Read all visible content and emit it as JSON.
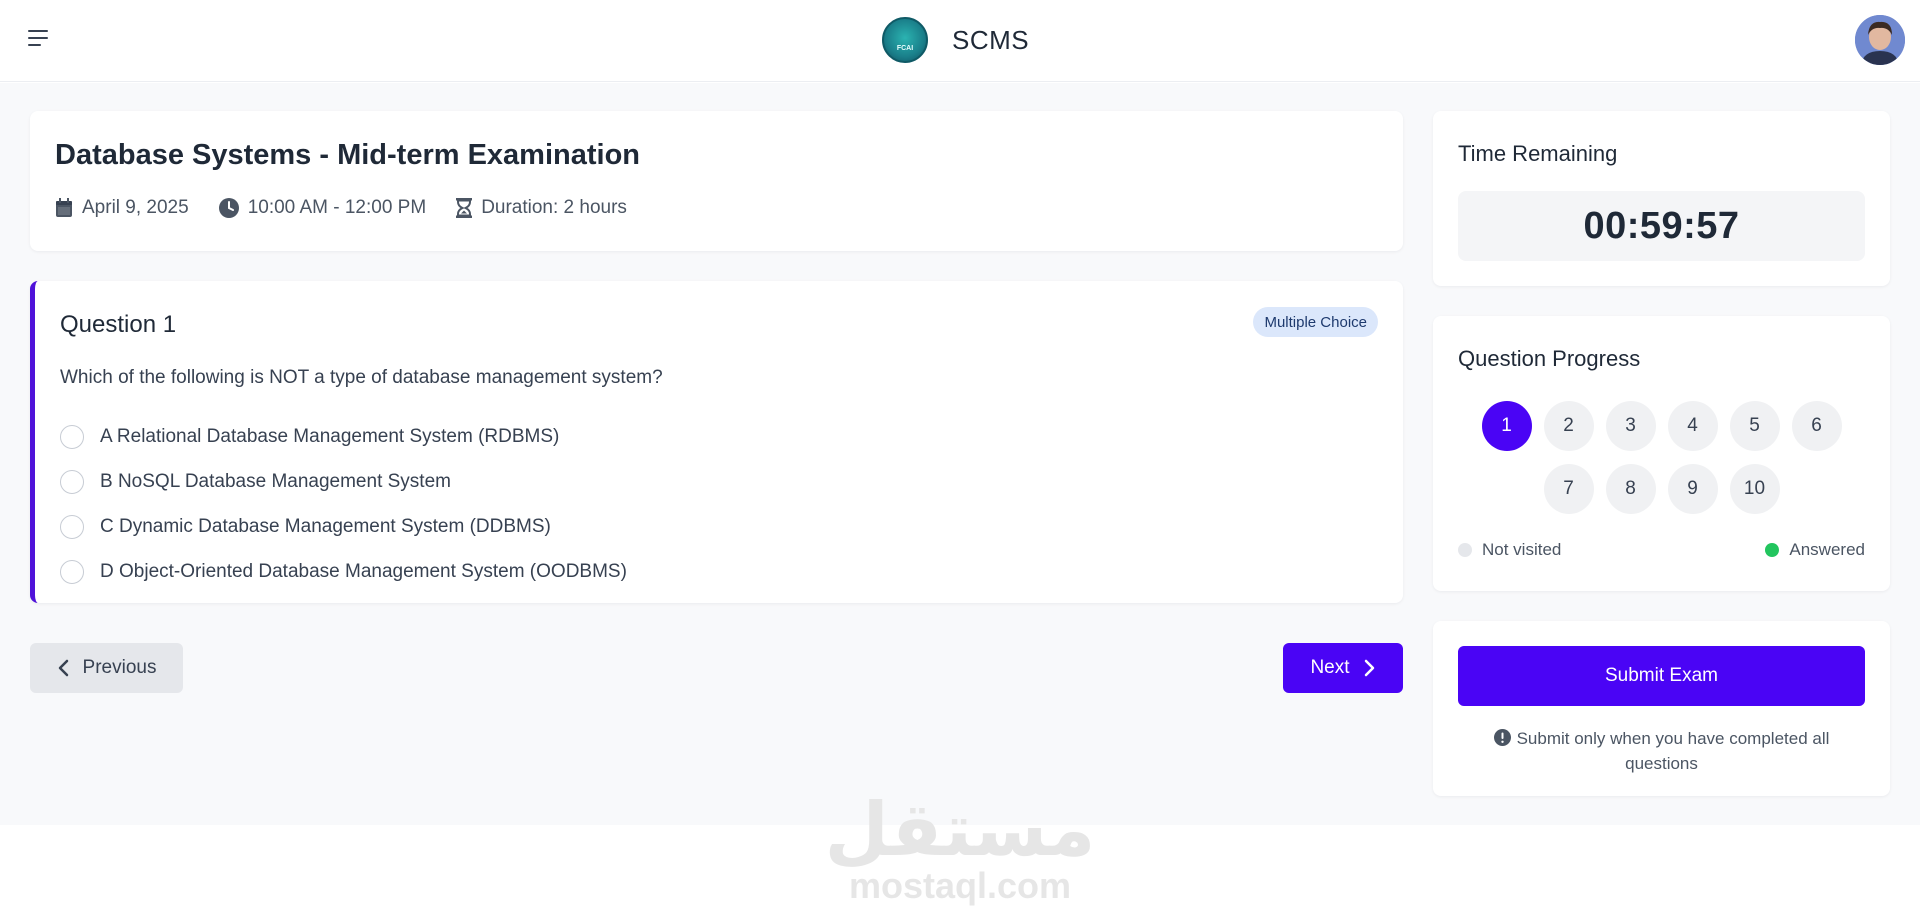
{
  "header": {
    "brand_name": "SCMS",
    "logo_text": "FCAI",
    "icons": {
      "menu": "menu-icon",
      "avatar": "user-avatar"
    }
  },
  "exam": {
    "title": "Database Systems - Mid-term Examination",
    "date": "April 9, 2025",
    "time": "10:00 AM - 12:00 PM",
    "duration": "Duration: 2 hours",
    "icons": {
      "date": "calendar-icon",
      "time": "clock-icon",
      "duration": "hourglass-icon"
    }
  },
  "question": {
    "title": "Question 1",
    "type_badge": "Multiple Choice",
    "text": "Which of the following is NOT a type of database management system?",
    "options": [
      {
        "label": "A Relational Database Management System (RDBMS)"
      },
      {
        "label": "B NoSQL Database Management System"
      },
      {
        "label": "C Dynamic Database Management System (DDBMS)"
      },
      {
        "label": "D Object-Oriented Database Management System (OODBMS)"
      }
    ]
  },
  "navigation": {
    "previous_label": "Previous",
    "next_label": "Next"
  },
  "timer": {
    "title": "Time Remaining",
    "value": "00:59:57"
  },
  "progress": {
    "title": "Question Progress",
    "current": 1,
    "questions": [
      "1",
      "2",
      "3",
      "4",
      "5",
      "6",
      "7",
      "8",
      "9",
      "10"
    ],
    "legend": {
      "not_visited": "Not visited",
      "answered": "Answered"
    }
  },
  "submit": {
    "button_label": "Submit Exam",
    "note": "Submit only when you have completed all questions"
  },
  "watermark": {
    "arabic": "مستقل",
    "latin": "mostaql.com"
  },
  "colors": {
    "accent": "#4a04f5",
    "answered": "#22c55e",
    "question_border": "#4f12d9",
    "badge_bg": "#dbe7fb"
  }
}
